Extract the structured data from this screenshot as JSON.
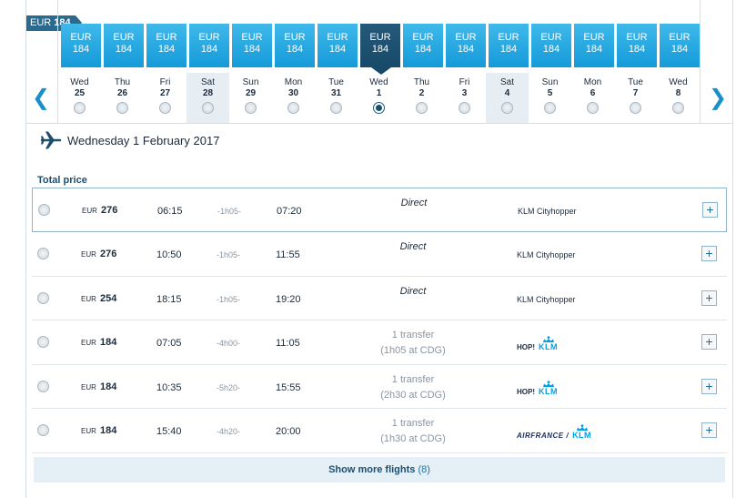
{
  "calendar": {
    "cheapest_tag": {
      "currency": "EUR",
      "amount": "184"
    },
    "prev_arrow": "❮",
    "next_arrow": "❯",
    "days": [
      {
        "currency": "EUR",
        "price": "184",
        "dow": "Wed",
        "date": "25",
        "weekend": false,
        "selected": false
      },
      {
        "currency": "EUR",
        "price": "184",
        "dow": "Thu",
        "date": "26",
        "weekend": false,
        "selected": false
      },
      {
        "currency": "EUR",
        "price": "184",
        "dow": "Fri",
        "date": "27",
        "weekend": false,
        "selected": false
      },
      {
        "currency": "EUR",
        "price": "184",
        "dow": "Sat",
        "date": "28",
        "weekend": true,
        "selected": false
      },
      {
        "currency": "EUR",
        "price": "184",
        "dow": "Sun",
        "date": "29",
        "weekend": false,
        "selected": false
      },
      {
        "currency": "EUR",
        "price": "184",
        "dow": "Mon",
        "date": "30",
        "weekend": false,
        "selected": false
      },
      {
        "currency": "EUR",
        "price": "184",
        "dow": "Tue",
        "date": "31",
        "weekend": false,
        "selected": false
      },
      {
        "currency": "EUR",
        "price": "184",
        "dow": "Wed",
        "date": "1",
        "weekend": false,
        "selected": true
      },
      {
        "currency": "EUR",
        "price": "184",
        "dow": "Thu",
        "date": "2",
        "weekend": false,
        "selected": false
      },
      {
        "currency": "EUR",
        "price": "184",
        "dow": "Fri",
        "date": "3",
        "weekend": false,
        "selected": false
      },
      {
        "currency": "EUR",
        "price": "184",
        "dow": "Sat",
        "date": "4",
        "weekend": true,
        "selected": false
      },
      {
        "currency": "EUR",
        "price": "184",
        "dow": "Sun",
        "date": "5",
        "weekend": false,
        "selected": false
      },
      {
        "currency": "EUR",
        "price": "184",
        "dow": "Mon",
        "date": "6",
        "weekend": false,
        "selected": false
      },
      {
        "currency": "EUR",
        "price": "184",
        "dow": "Tue",
        "date": "7",
        "weekend": false,
        "selected": false
      },
      {
        "currency": "EUR",
        "price": "184",
        "dow": "Wed",
        "date": "8",
        "weekend": false,
        "selected": false
      }
    ]
  },
  "header": {
    "icon": "plane-icon",
    "date_text": "Wednesday 1 February 2017"
  },
  "results": {
    "total_price_label": "Total price",
    "flights": [
      {
        "currency": "EUR",
        "price": "276",
        "depart": "06:15",
        "duration": "-1h05-",
        "arrive": "07:20",
        "stops": "Direct",
        "transfer": "",
        "carrier_text": "KLM Cityhopper",
        "logo": "",
        "selected": true
      },
      {
        "currency": "EUR",
        "price": "276",
        "depart": "10:50",
        "duration": "-1h05-",
        "arrive": "11:55",
        "stops": "Direct",
        "transfer": "",
        "carrier_text": "KLM Cityhopper",
        "logo": "",
        "selected": false
      },
      {
        "currency": "EUR",
        "price": "254",
        "depart": "18:15",
        "duration": "-1h05-",
        "arrive": "19:20",
        "stops": "Direct",
        "transfer": "",
        "carrier_text": "KLM Cityhopper",
        "logo": "",
        "selected": false
      },
      {
        "currency": "EUR",
        "price": "184",
        "depart": "07:05",
        "duration": "-4h00-",
        "arrive": "11:05",
        "stops": "1 transfer",
        "transfer": "(1h05 at CDG)",
        "carrier_text": "",
        "logo": "hop",
        "logo_prefix": "HOP!",
        "logo_klm": "KLM",
        "selected": false
      },
      {
        "currency": "EUR",
        "price": "184",
        "depart": "10:35",
        "duration": "-5h20-",
        "arrive": "15:55",
        "stops": "1 transfer",
        "transfer": "(2h30 at CDG)",
        "carrier_text": "",
        "logo": "hop",
        "logo_prefix": "HOP!",
        "logo_klm": "KLM",
        "selected": false
      },
      {
        "currency": "EUR",
        "price": "184",
        "depart": "15:40",
        "duration": "-4h20-",
        "arrive": "20:00",
        "stops": "1 transfer",
        "transfer": "(1h30 at CDG)",
        "carrier_text": "",
        "logo": "af",
        "logo_prefix": "AIRFRANCE /",
        "logo_klm": "KLM",
        "selected": false
      }
    ],
    "expand_label": "+",
    "show_more": {
      "label": "Show more flights",
      "count": "(8)"
    }
  }
}
